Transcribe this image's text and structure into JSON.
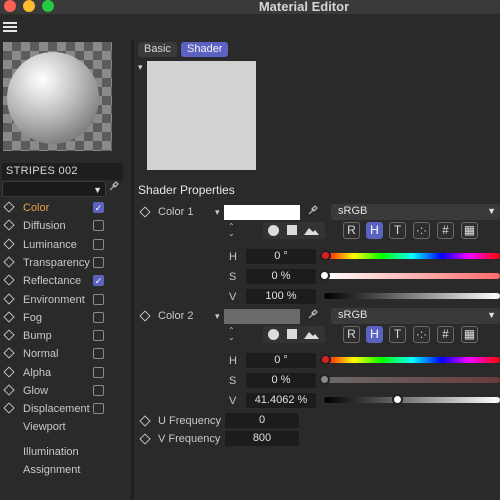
{
  "window": {
    "title": "Material Editor"
  },
  "material": {
    "name": "STRIPES 002"
  },
  "channels": [
    {
      "label": "Color",
      "checked": true,
      "active": true
    },
    {
      "label": "Diffusion",
      "checked": false
    },
    {
      "label": "Luminance",
      "checked": false
    },
    {
      "label": "Transparency",
      "checked": false
    },
    {
      "label": "Reflectance",
      "checked": true
    },
    {
      "label": "Environment",
      "checked": false
    },
    {
      "label": "Fog",
      "checked": false
    },
    {
      "label": "Bump",
      "checked": false
    },
    {
      "label": "Normal",
      "checked": false
    },
    {
      "label": "Alpha",
      "checked": false
    },
    {
      "label": "Glow",
      "checked": false
    },
    {
      "label": "Displacement",
      "checked": false
    }
  ],
  "extra_items": [
    "Viewport",
    "Illumination",
    "Assignment"
  ],
  "tabs": {
    "basic": "Basic",
    "shader": "Shader"
  },
  "shader": {
    "section_title": "Shader Properties",
    "color1": {
      "label": "Color 1",
      "swatch": "#ffffff",
      "color_space": "sRGB",
      "h": "0 °",
      "s": "0 %",
      "v": "100 %",
      "s_fraction": 0.0,
      "v_fraction": 1.0
    },
    "color2": {
      "label": "Color 2",
      "swatch": "#6a6a6a",
      "color_space": "sRGB",
      "h": "0 °",
      "s": "0 %",
      "v": "41.4062 %",
      "s_fraction": 0.0,
      "v_fraction": 0.414062
    },
    "mode_buttons": [
      "R",
      "H",
      "T",
      "·:·",
      "#",
      "▦"
    ],
    "channel_labels": {
      "h": "H",
      "s": "S",
      "v": "V"
    },
    "u_frequency": {
      "label": "U Frequency",
      "value": "0"
    },
    "v_frequency": {
      "label": "V Frequency",
      "value": "800"
    }
  },
  "colors": {
    "accent": "#5b62c0",
    "active_channel": "#e8a050"
  }
}
